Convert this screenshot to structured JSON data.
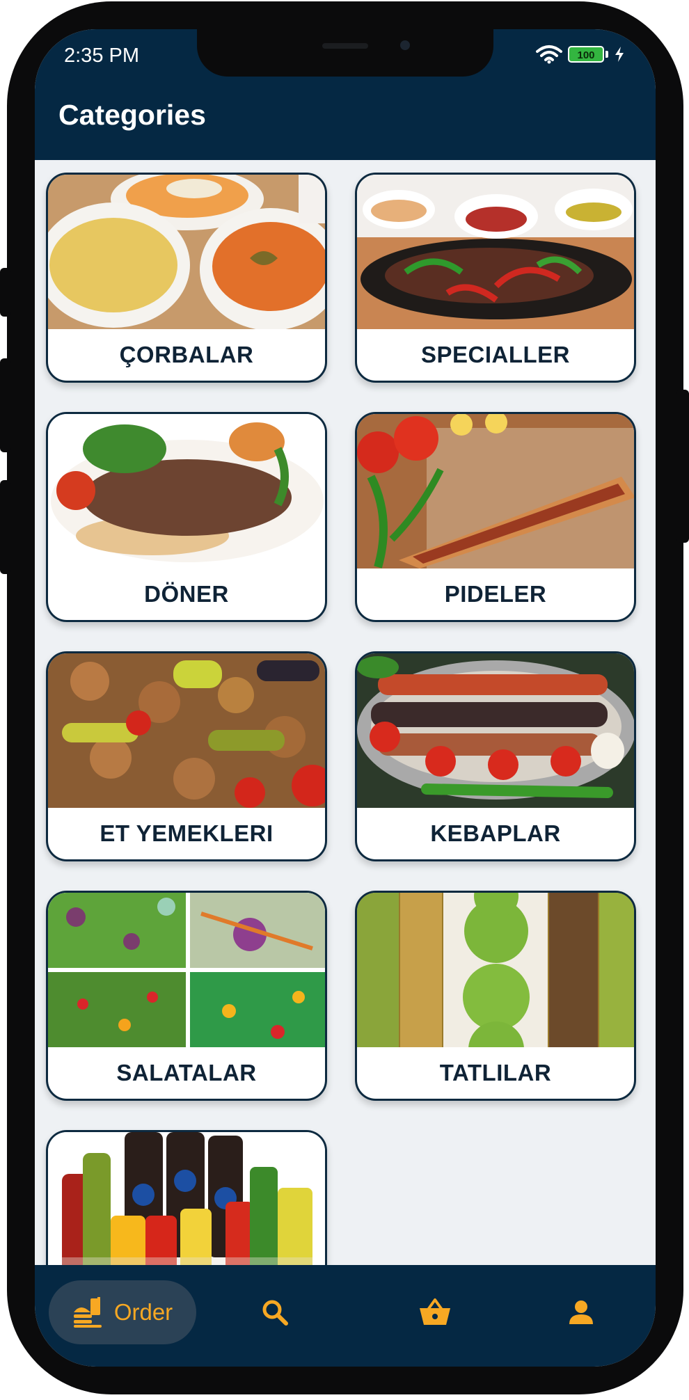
{
  "status_bar": {
    "time": "2:35 PM",
    "battery": "100"
  },
  "header": {
    "title": "Categories"
  },
  "categories": [
    {
      "label": "ÇORBALAR",
      "image": "soup-bowls"
    },
    {
      "label": "SPECIALLER",
      "image": "sizzling-meat-pan"
    },
    {
      "label": "DÖNER",
      "image": "doner-plate"
    },
    {
      "label": "PIDELER",
      "image": "pide-flatbread"
    },
    {
      "label": "ET YEMEKLERI",
      "image": "meat-stew"
    },
    {
      "label": "KEBAPLAR",
      "image": "kebab-platter"
    },
    {
      "label": "SALATALAR",
      "image": "salad-collage"
    },
    {
      "label": "TATLILAR",
      "image": "baklava-tray"
    },
    {
      "label": "",
      "image": "soft-drink-bottles"
    }
  ],
  "bottom_nav": {
    "order_label": "Order",
    "items": [
      "order-icon",
      "search-icon",
      "basket-icon",
      "profile-icon"
    ]
  },
  "colors": {
    "header": "#052843",
    "accent": "#f7a823",
    "card_border": "#0d2a40",
    "background": "#eef1f4"
  }
}
